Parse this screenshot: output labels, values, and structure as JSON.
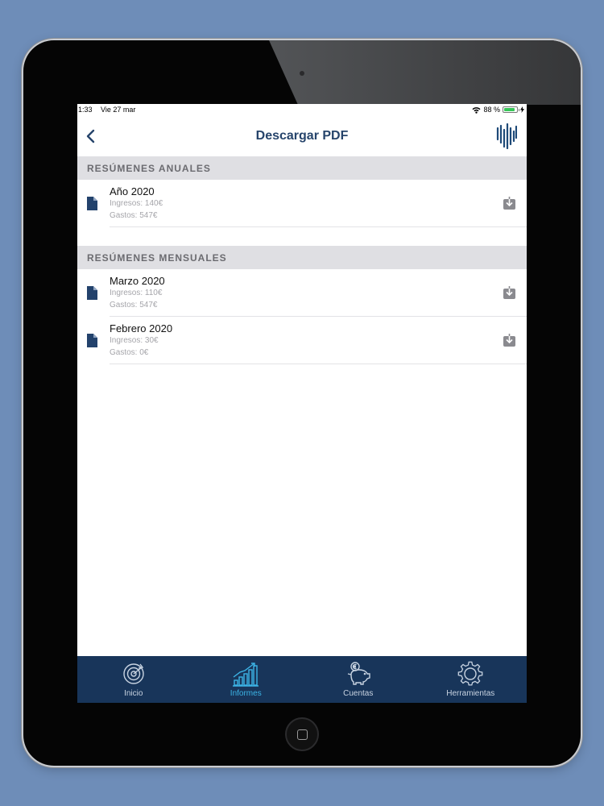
{
  "statusbar": {
    "time": "1:33",
    "date": "Vie 27 mar",
    "battery": "88 %"
  },
  "navbar": {
    "title": "Descargar PDF"
  },
  "annual": {
    "header": "RESÚMENES ANUALES",
    "items": [
      {
        "title": "Año 2020",
        "income": "Ingresos: 140€",
        "expenses": "Gastos: 547€"
      }
    ]
  },
  "monthly": {
    "header": "RESÚMENES MENSUALES",
    "items": [
      {
        "title": "Marzo 2020",
        "income": "Ingresos: 110€",
        "expenses": "Gastos: 547€"
      },
      {
        "title": "Febrero 2020",
        "income": "Ingresos: 30€",
        "expenses": "Gastos: 0€"
      }
    ]
  },
  "tabs": {
    "inicio": "Inicio",
    "informes": "Informes",
    "cuentas": "Cuentas",
    "herramientas": "Herramientas",
    "active": "informes"
  },
  "colors": {
    "background": "#6e8db8",
    "navy": "#18355a",
    "title": "#26446b",
    "active_tab": "#3cb4e6",
    "section_header": "#dfdfe3"
  }
}
